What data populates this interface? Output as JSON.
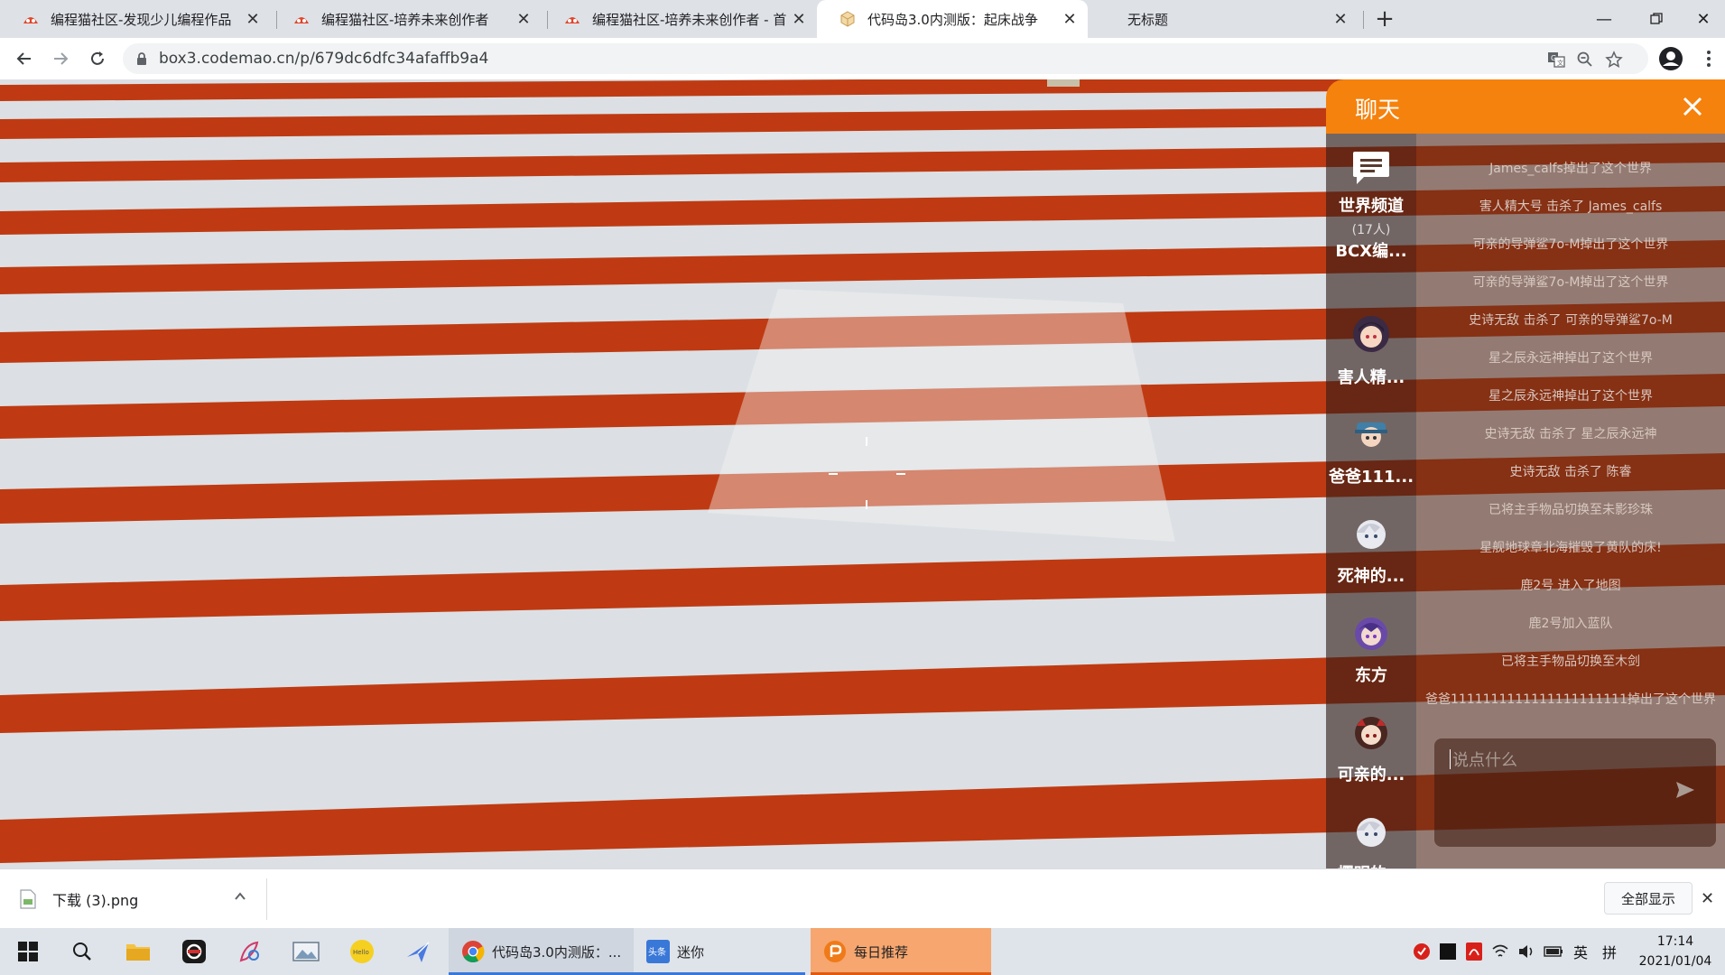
{
  "browser": {
    "tabs": [
      {
        "title": "编程猫社区-发现少儿编程作品",
        "active": false
      },
      {
        "title": "编程猫社区-培养未来创作者",
        "active": false
      },
      {
        "title": "编程猫社区-培养未来创作者 - 首",
        "active": false
      },
      {
        "title": "代码岛3.0内测版：起床战争",
        "active": true
      },
      {
        "title": "无标题",
        "active": false
      }
    ],
    "url": "box3.codemao.cn/p/679dc6dfc34afaffb9a4"
  },
  "chat": {
    "title": "聊天",
    "world_channel": {
      "name": "世界频道",
      "count": "(17人)"
    },
    "users": [
      "BCX编...",
      "害人精...",
      "爸爸111...",
      "死神的...",
      "东方",
      "可亲的...",
      "樱明的..."
    ],
    "messages": [
      "James_calfs掉出了这个世界",
      "害人精大号 击杀了 James_calfs",
      "可亲的导弹鲨7o-M掉出了这个世界",
      "可亲的导弹鲨7o-M掉出了这个世界",
      "史诗无敌 击杀了 可亲的导弹鲨7o-M",
      "星之辰永远神掉出了这个世界",
      "星之辰永远神掉出了这个世界",
      "史诗无敌 击杀了 星之辰永远神",
      "史诗无敌 击杀了 陈睿",
      "已将主手物品切换至未影珍珠",
      "星舰地球章北海摧毁了黄队的床!",
      "鹿2号 进入了地图",
      "鹿2号加入蓝队",
      "已将主手物品切换至木剑",
      "爸爸1111111111111111111111掉出了这个世界"
    ],
    "input_placeholder": "说点什么"
  },
  "downloads": {
    "file": "下载 (3).png",
    "show_all": "全部显示"
  },
  "taskbar": {
    "apps": [
      {
        "label": "代码岛3.0内测版：..."
      },
      {
        "label": "迷你"
      },
      {
        "label": "每日推荐"
      }
    ],
    "ime": "英",
    "ime2": "拼",
    "time": "17:14",
    "date": "2021/01/04"
  },
  "colors": {
    "chat_header": "#f5820d",
    "floor_red": "#bf3a12",
    "floor_white": "#dce0e4"
  }
}
